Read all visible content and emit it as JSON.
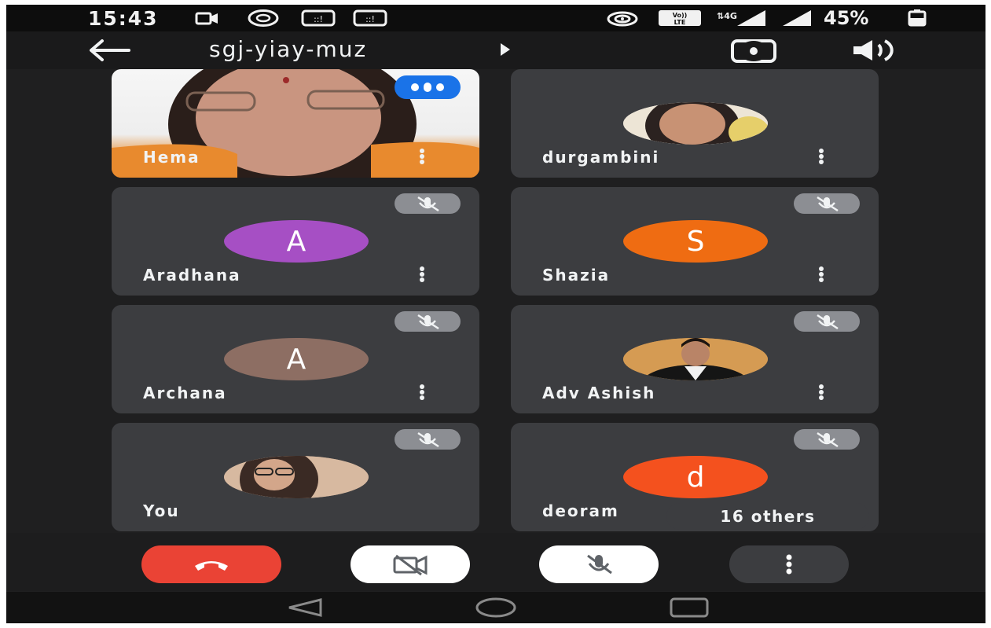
{
  "status_bar": {
    "time": "15:43",
    "battery_percent": "45%",
    "network": "4G"
  },
  "header": {
    "meeting_code": "sgj-yiay-muz",
    "back_icon": "back-arrow-icon",
    "switch_camera_icon": "switch-camera-icon",
    "speaker_icon": "speaker-icon"
  },
  "participants": [
    {
      "name": "Hema",
      "type": "video",
      "speaking": true
    },
    {
      "name": "durgambini",
      "type": "photo"
    },
    {
      "name": "Aradhana",
      "type": "initial",
      "initial": "A",
      "color": "#a64fc4",
      "muted": true
    },
    {
      "name": "Shazia",
      "type": "initial",
      "initial": "S",
      "color": "#ef6c12",
      "muted": true
    },
    {
      "name": "Archana",
      "type": "initial",
      "initial": "A",
      "color": "#8d6e63",
      "muted": true
    },
    {
      "name": "Adv Ashish",
      "type": "photo",
      "muted": true
    },
    {
      "name": "You",
      "type": "photo",
      "muted": true
    },
    {
      "name": "deoram",
      "type": "initial",
      "initial": "d",
      "color": "#f4511e",
      "muted": true
    }
  ],
  "others_label": "16 others",
  "controls": {
    "end_call_color": "#ea4335",
    "end_call_icon": "phone-hangup-icon",
    "camera_icon": "camera-off-icon",
    "mic_icon": "mic-off-icon",
    "more_icon": "more-vertical-icon"
  },
  "nav": {
    "back_icon": "nav-back-icon",
    "home_icon": "nav-home-icon",
    "recents_icon": "nav-recents-icon"
  }
}
